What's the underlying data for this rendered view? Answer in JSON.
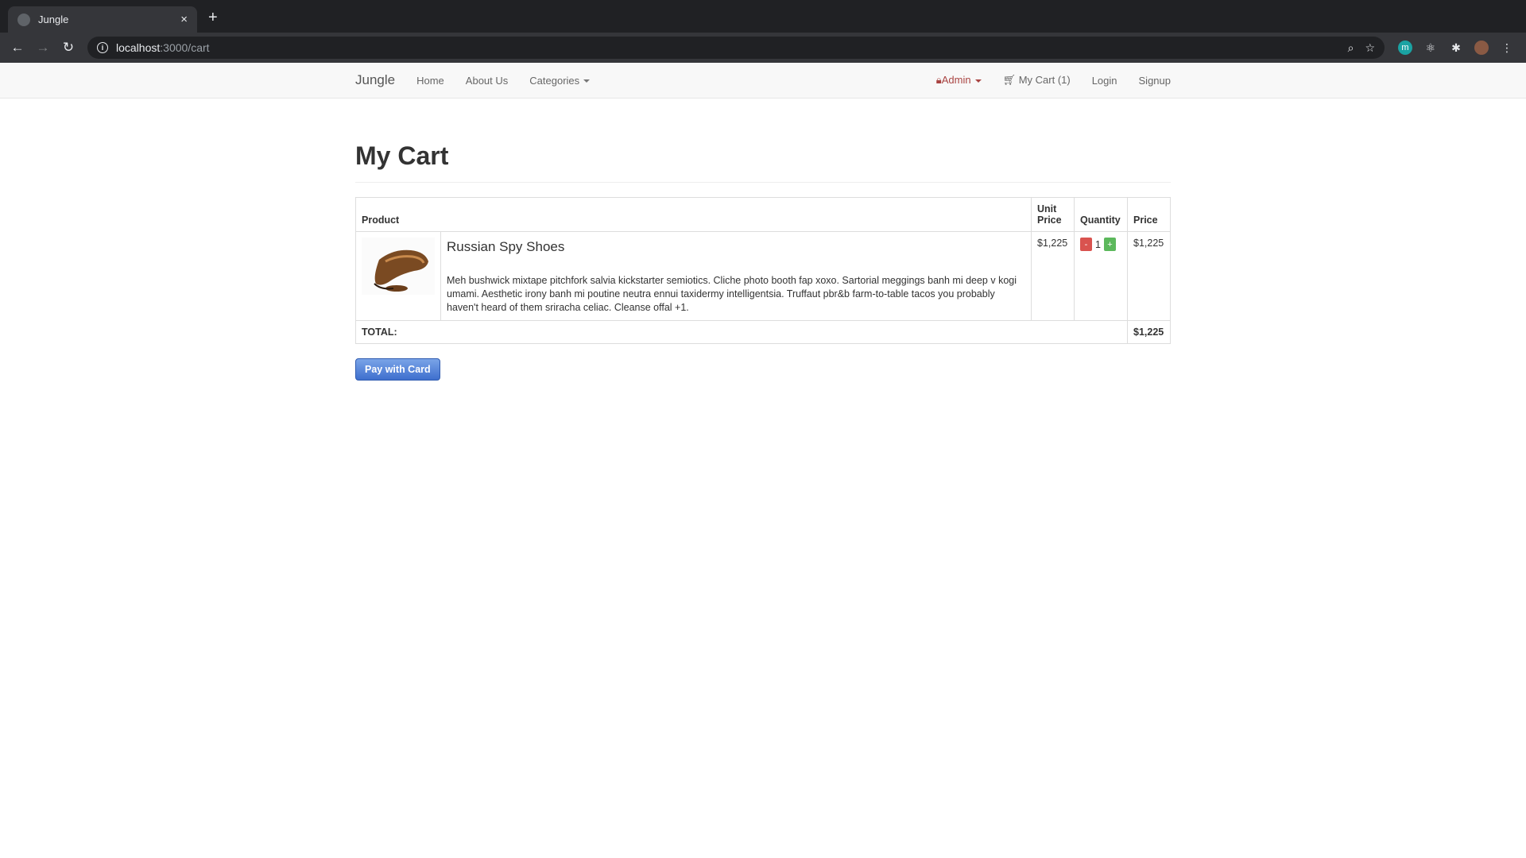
{
  "browser": {
    "tab_title": "Jungle",
    "tab_close": "×",
    "new_tab": "+",
    "url_host": "localhost",
    "url_path": ":3000/cart",
    "back": "←",
    "forward": "→",
    "reload": "↻",
    "ext_m": "m"
  },
  "nav": {
    "brand": "Jungle",
    "home": "Home",
    "about": "About Us",
    "categories": "Categories",
    "admin": "Admin",
    "cart": "My Cart (1)",
    "login": "Login",
    "signup": "Signup"
  },
  "page": {
    "title": "My Cart",
    "columns": {
      "product": "Product",
      "unit_price_1": "Unit",
      "unit_price_2": "Price",
      "quantity": "Quantity",
      "price": "Price"
    },
    "items": [
      {
        "name": "Russian Spy Shoes",
        "description": "Meh bushwick mixtape pitchfork salvia kickstarter semiotics. Cliche photo booth fap xoxo. Sartorial meggings banh mi deep v kogi umami. Aesthetic irony banh mi poutine neutra ennui taxidermy intelligentsia. Truffaut pbr&b farm-to-table tacos you probably haven't heard of them sriracha celiac. Cleanse offal +1.",
        "unit_price": "$1,225",
        "quantity": "1",
        "price": "$1,225",
        "minus_label": "-",
        "plus_label": "+"
      }
    ],
    "total_label": "TOTAL:",
    "total_value": "$1,225",
    "pay_button": "Pay with Card"
  },
  "colors": {
    "pay_button": "#3e6fce",
    "minus_button": "#d9534f",
    "plus_button": "#5cb85c",
    "admin_link": "#a94442"
  }
}
